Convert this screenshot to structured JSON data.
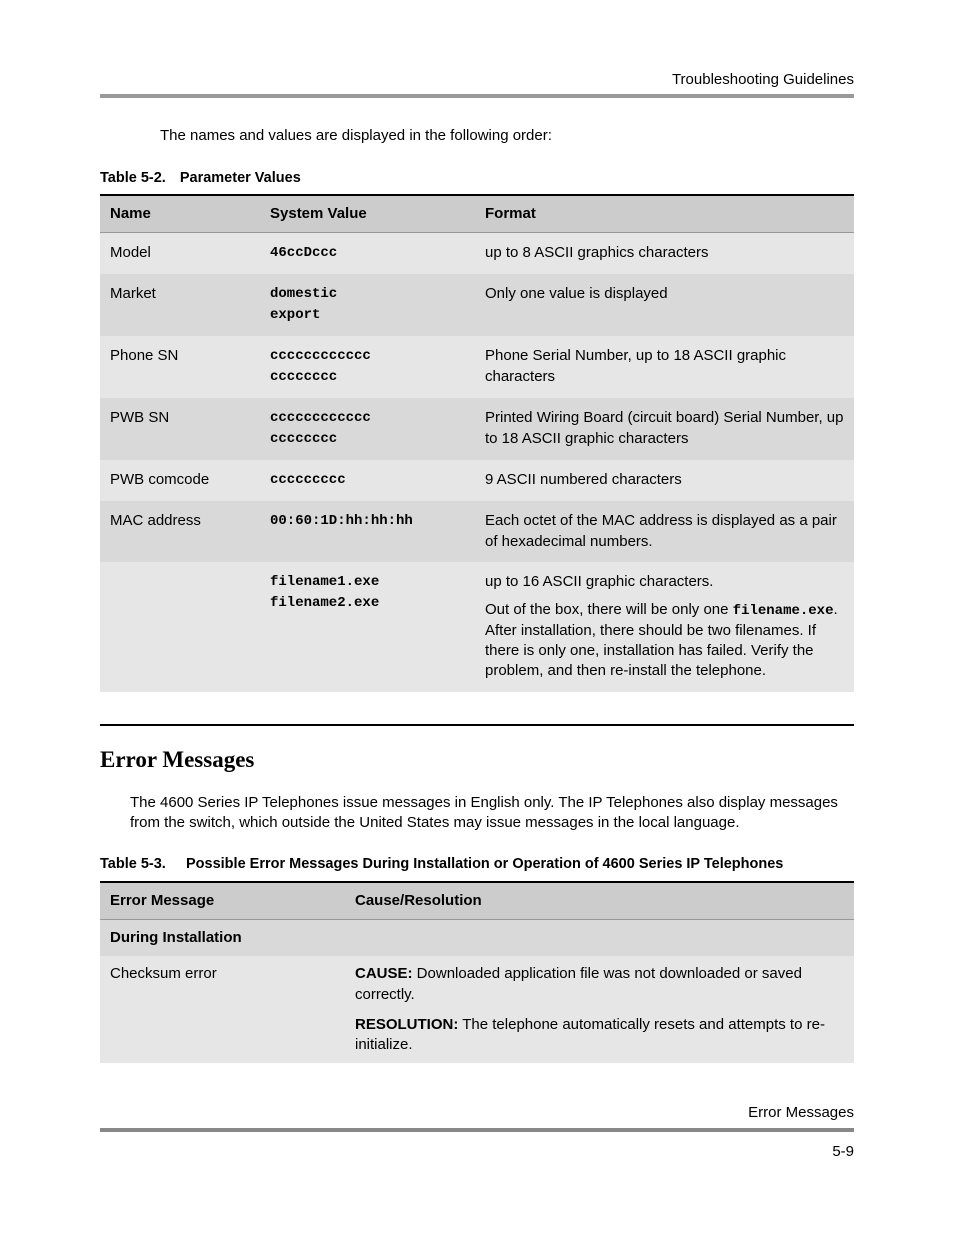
{
  "header": {
    "title": "Troubleshooting Guidelines"
  },
  "intro": "The names and values are displayed in the following order:",
  "table52": {
    "number": "Table 5-2.",
    "title": "Parameter Values",
    "headers": {
      "name": "Name",
      "system": "System Value",
      "format": "Format"
    },
    "rows": [
      {
        "name": "Model",
        "system": "46ccDccc",
        "format_plain": "up to 8 ASCII graphics characters"
      },
      {
        "name": "Market",
        "system": "domestic\nexport",
        "format_plain": "Only one value is displayed"
      },
      {
        "name": "Phone SN",
        "system": "cccccccccccc\ncccccccc",
        "format_plain": "Phone Serial Number, up to 18 ASCII graphic characters"
      },
      {
        "name": "PWB SN",
        "system": "cccccccccccc\ncccccccc",
        "format_plain": "Printed Wiring Board (circuit board) Serial Number, up to 18 ASCII graphic characters"
      },
      {
        "name": "PWB comcode",
        "system": "ccccccccc",
        "format_plain": "9 ASCII numbered characters"
      },
      {
        "name": "MAC address",
        "system": "00:60:1D:hh:hh:hh",
        "format_plain": "Each octet of the MAC address is displayed as a pair of hexadecimal numbers."
      },
      {
        "name": "",
        "system": "filename1.exe\nfilename2.exe",
        "format_line1": "up to 16 ASCII graphic characters.",
        "format_pre": "Out of the box, there will be only one ",
        "format_code": "filename.exe",
        "format_post": ". After installation, there should be two filenames. If there is only one, installation has failed. Verify the problem, and then re-install the telephone."
      }
    ]
  },
  "section": {
    "heading": "Error Messages",
    "intro": "The 4600 Series IP Telephones issue messages in English only. The IP Telephones also display messages from the switch, which outside the United States may issue messages in the local language."
  },
  "table53": {
    "number": "Table 5-3.",
    "title": "Possible Error Messages During Installation or Operation of 4600 Series IP Telephones",
    "headers": {
      "msg": "Error Message",
      "cause": "Cause/Resolution"
    },
    "section_label": "During Installation",
    "row": {
      "msg": "Checksum error",
      "cause_label": "CAUSE:",
      "cause_text": " Downloaded application file was not downloaded or saved correctly.",
      "res_label": "RESOLUTION:",
      "res_text": " The telephone automatically resets and attempts to re-initialize."
    }
  },
  "footer": {
    "title": "Error Messages",
    "page": "5-9"
  }
}
